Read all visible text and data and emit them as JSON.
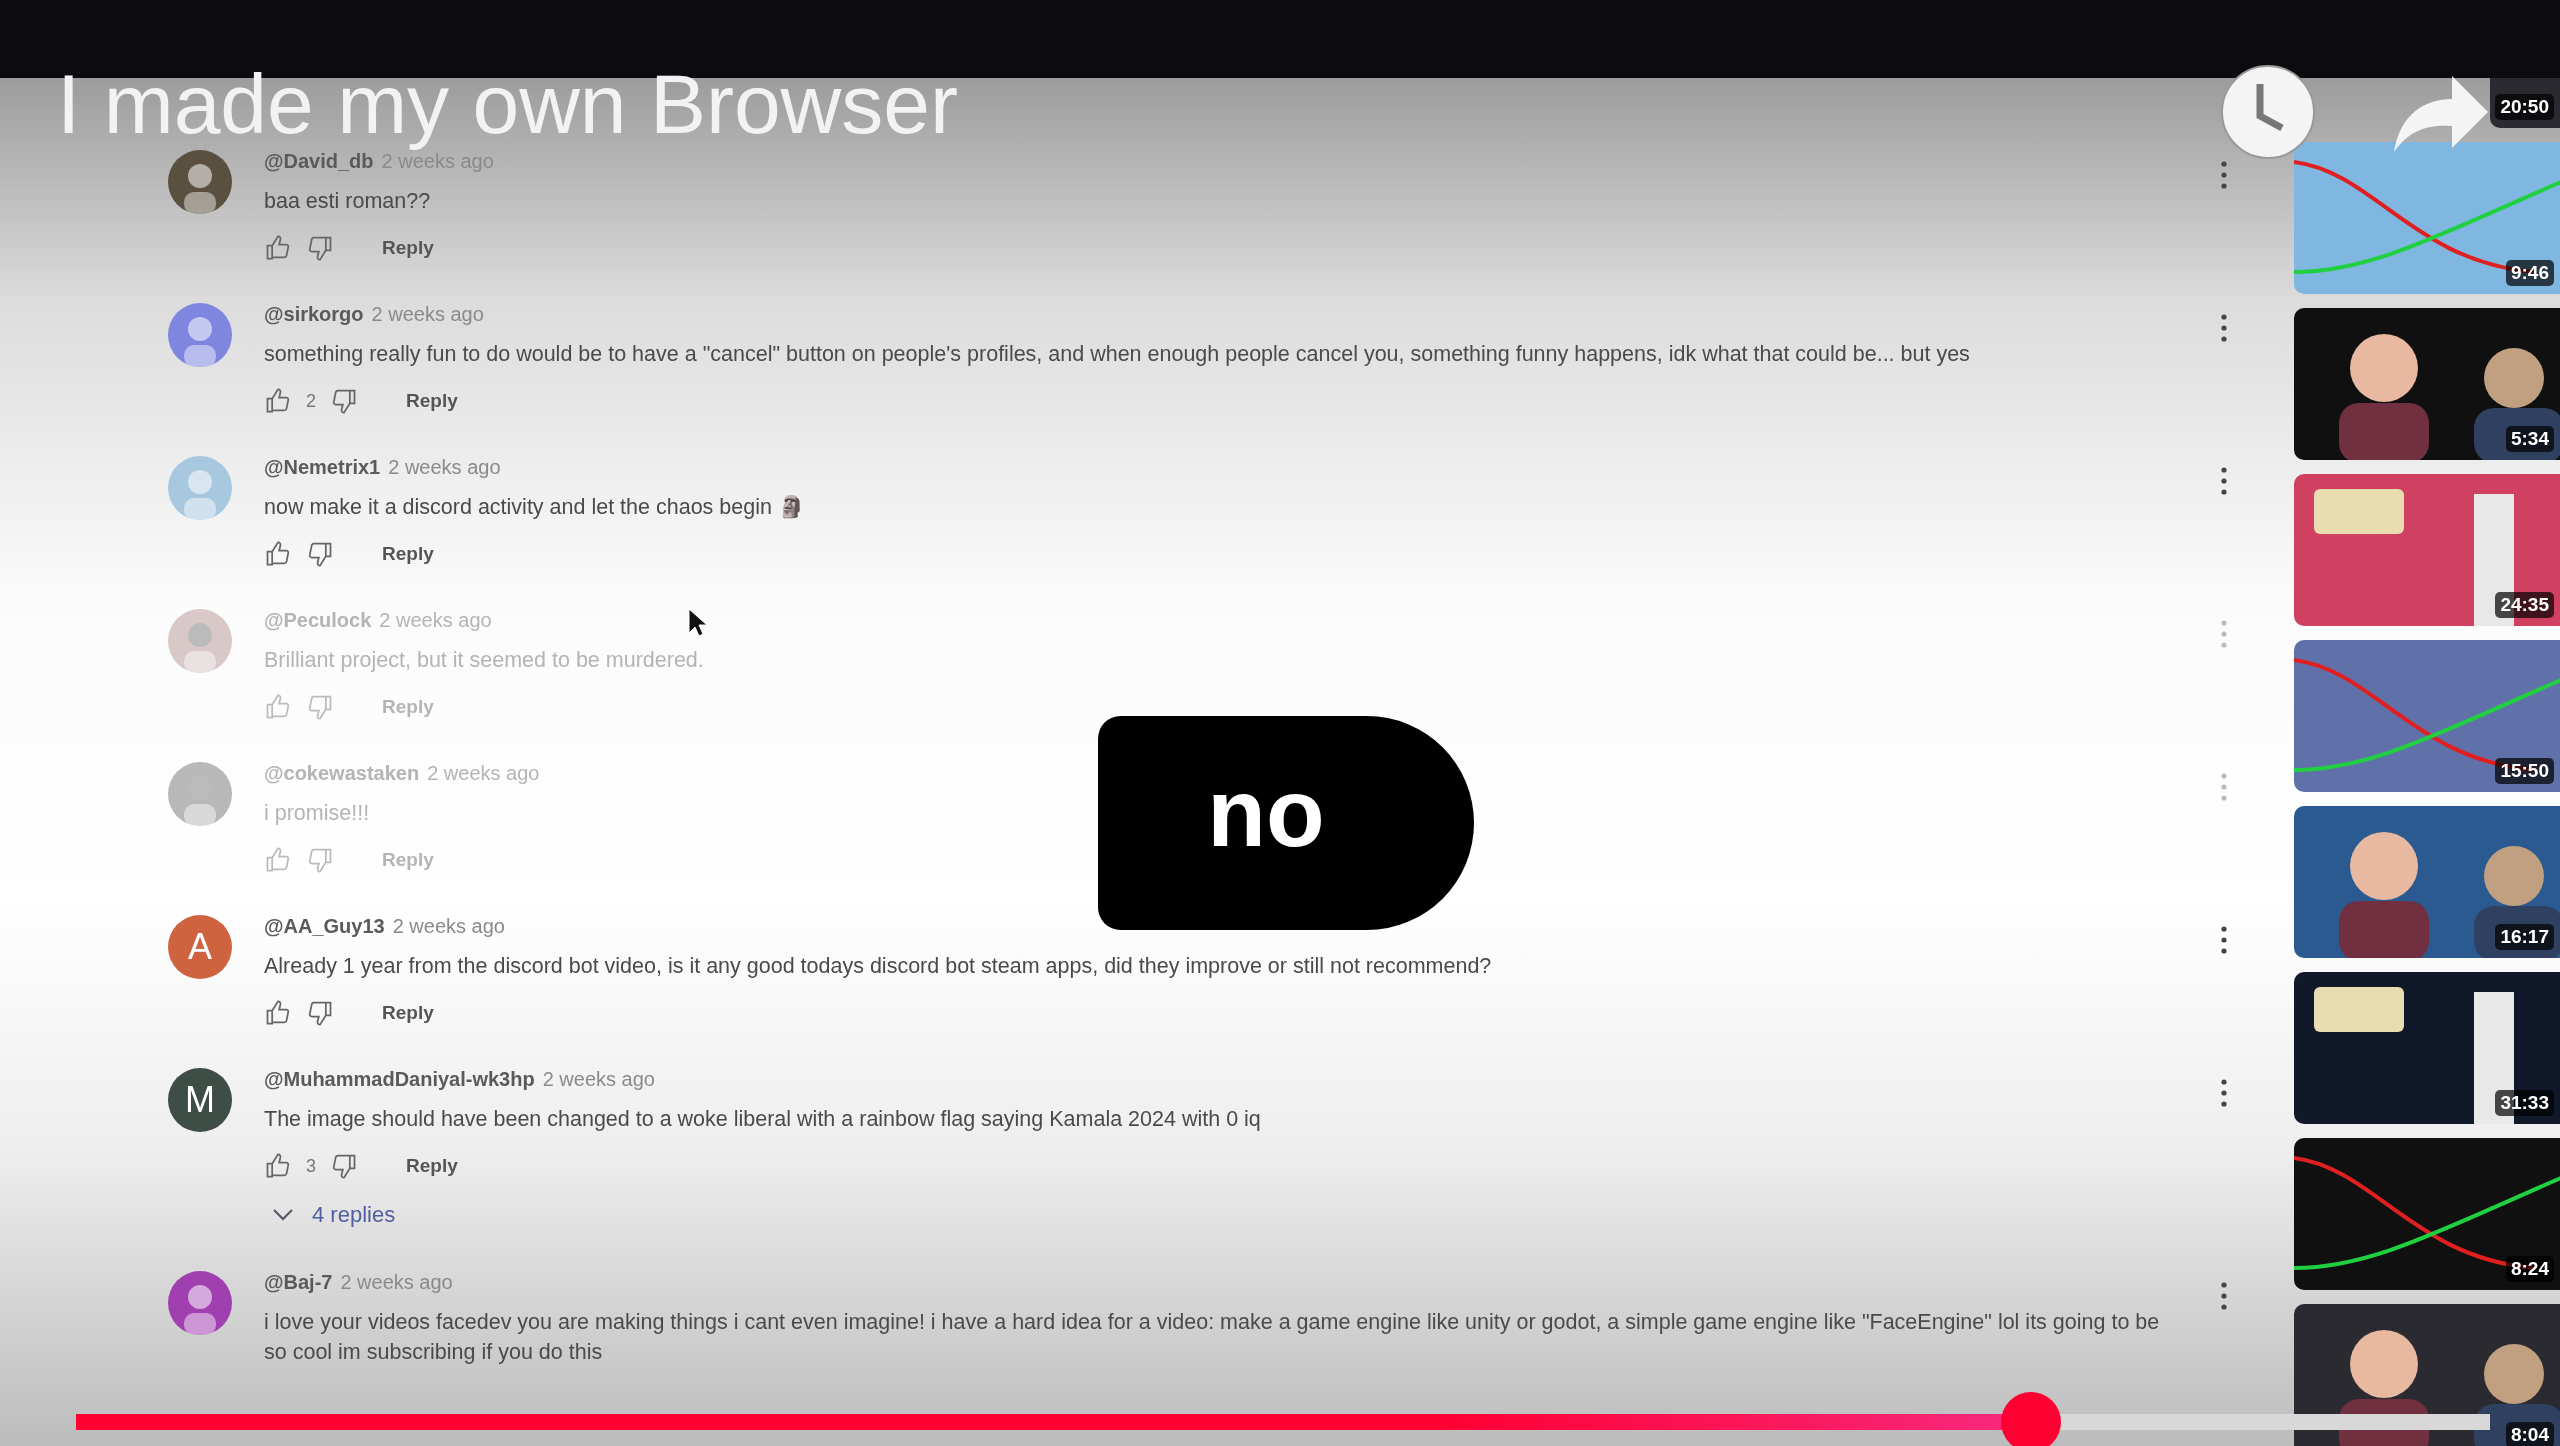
{
  "video": {
    "title": "I made my own Browser",
    "overlay_text": "no",
    "progress": {
      "level": 0.81
    }
  },
  "comments": [
    {
      "author": "@David_db",
      "time": "2 weeks ago",
      "text": "baa esti roman??",
      "faded": false,
      "reply_label": "Reply"
    },
    {
      "author": "@sirkorgo",
      "time": "2 weeks ago",
      "text": "something really fun to do would be to have a \"cancel\" button on people's profiles, and when enough people cancel you, something funny happens, idk what that could be... but yes",
      "likes": "2",
      "faded": false,
      "reply_label": "Reply"
    },
    {
      "author": "@Nemetrix1",
      "time": "2 weeks ago",
      "text": "now make it a discord activity and let the chaos begin 🗿",
      "faded": false,
      "reply_label": "Reply"
    },
    {
      "author": "@Peculock",
      "time": "2 weeks ago",
      "text": "Brilliant project, but it seemed to be murdered.",
      "faded": true,
      "reply_label": "Reply"
    },
    {
      "author": "@cokewastaken",
      "time": "2 weeks ago",
      "text": "i promise!!!",
      "faded": true,
      "reply_label": "Reply"
    },
    {
      "author": "@AA_Guy13",
      "time": "2 weeks ago",
      "text": "Already 1 year from the discord bot video, is it any good todays discord bot steam apps, did they improve or still not recommend?",
      "avatar": {
        "kind": "letter",
        "letter": "A",
        "color": "#d0633f"
      },
      "faded": false,
      "reply_label": "Reply"
    },
    {
      "author": "@MuhammadDaniyal-wk3hp",
      "time": "2 weeks ago",
      "text": "The image should have been changed to a woke liberal with a rainbow flag saying Kamala 2024 with 0 iq",
      "avatar": {
        "kind": "letter",
        "letter": "M",
        "color": "#3e4d45"
      },
      "likes": "3",
      "faded": false,
      "reply_label": "Reply",
      "replies": "4 replies"
    },
    {
      "author": "@Baj-7",
      "time": "2 weeks ago",
      "text": "i love your videos facedev you are making things i cant even imagine! i have a hard idea for a video: make a game engine like unity or godot, a simple game engine like \"FaceEngine\" lol its going to be so cool im subscribing if you do this",
      "faded": false
    }
  ],
  "thumbnails": [
    {
      "duration": "20:50"
    },
    {
      "duration": "9:46"
    },
    {
      "duration": "5:34"
    },
    {
      "duration": "24:35"
    },
    {
      "duration": "15:50"
    },
    {
      "duration": "16:17"
    },
    {
      "duration": "31:33"
    },
    {
      "duration": "8:24"
    },
    {
      "duration": "8:04"
    }
  ]
}
